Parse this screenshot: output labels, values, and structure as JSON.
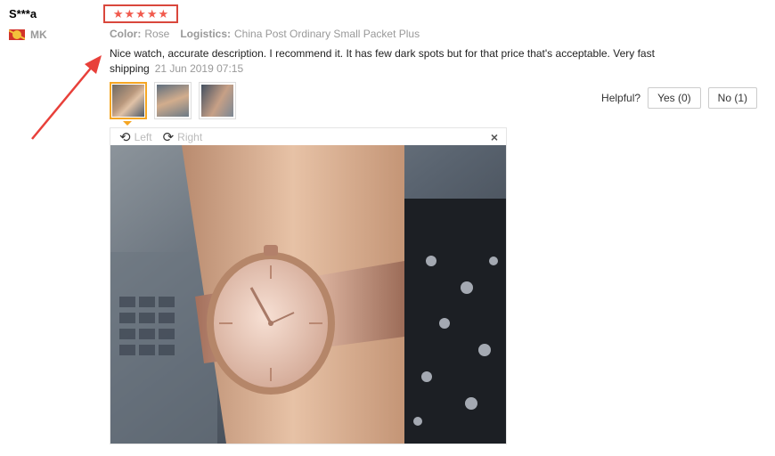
{
  "user": {
    "name": "S***a",
    "country": "MK"
  },
  "rating": {
    "stars": 5
  },
  "meta": {
    "color_label": "Color:",
    "color_value": "Rose",
    "logistics_label": "Logistics:",
    "logistics_value": "China Post Ordinary Small Packet Plus"
  },
  "review": {
    "text": "Nice watch, accurate description. I recommend it. It has few dark spots but for that price that's acceptable. Very fast shipping",
    "date": "21 Jun 2019 07:15"
  },
  "helpful": {
    "label": "Helpful?",
    "yes_label": "Yes (0)",
    "no_label": "No (1)"
  },
  "viewer": {
    "left_label": "Left",
    "right_label": "Right",
    "close_glyph": "×",
    "rotate_left_icon": "rotate-left-icon",
    "rotate_right_icon": "rotate-right-icon"
  },
  "colors": {
    "star": "#f15a4d",
    "highlight_box": "#d9473c",
    "arrow": "#e8403a",
    "active_thumb": "#f5a623"
  }
}
